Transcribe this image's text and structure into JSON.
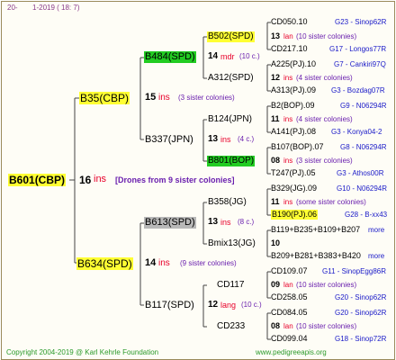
{
  "header": {
    "left": "20-",
    "date": "1-2019 ( 18: 7)"
  },
  "footer": {
    "copyright": "Copyright 2004-2019 @ Karl Kehrle Foundation",
    "url": "www.pedigreeapis.org"
  },
  "root": {
    "name": "B601(CBP)",
    "num": "16",
    "ins": "ins",
    "note": "[Drones from 9 sister colonies]"
  },
  "gen1": [
    {
      "name": "B35(CBP)",
      "num": "15",
      "ins": "ins",
      "note": "(3 sister colonies)"
    },
    {
      "name": "B634(SPD)",
      "num": "14",
      "ins": "ins",
      "note": "(9 sister colonies)"
    }
  ],
  "gen2": [
    {
      "name": "B484(SPD)",
      "num": "14",
      "ins": "mdr",
      "note": "(10 c.)"
    },
    {
      "name": "B337(JPN)",
      "num": "13",
      "ins": "ins",
      "note": "(4 c.)"
    },
    {
      "name": "B613(SPD)",
      "num": "13",
      "ins": "ins",
      "note": "(8 c.)"
    },
    {
      "name": "B117(SPD)",
      "num": "12",
      "ins": "lang",
      "note": "(10 c.)"
    }
  ],
  "gen3": [
    {
      "name": "B502(SPD)",
      "num": "13",
      "ins": "lan",
      "note": "(10 sister colonies)"
    },
    {
      "name": "A312(SPD)",
      "num": "12",
      "ins": "ins",
      "note": "(4 sister colonies)"
    },
    {
      "name": "B124(JPN)",
      "num": "11",
      "ins": "ins",
      "note": "(4 sister colonies)"
    },
    {
      "name": "B801(BOP)",
      "num": "08",
      "ins": "ins",
      "note": "(3 sister colonies)"
    },
    {
      "name": "B358(JG)",
      "num": "11",
      "ins": "ins",
      "note": "(some sister colonies)"
    },
    {
      "name": "Bmix13(JG)",
      "num": "10",
      "ins": "",
      "note": ""
    },
    {
      "name": "CD117",
      "num": "09",
      "ins": "lan",
      "note": "(10 sister colonies)"
    },
    {
      "name": "CD233",
      "num": "08",
      "ins": "lan",
      "note": "(10 sister colonies)"
    }
  ],
  "gen4": [
    {
      "name": "CD050.10",
      "id": "G23 - Sinop62R"
    },
    {
      "name": "CD217.10",
      "id": "G17 - Longos77R"
    },
    {
      "name": "A225(PJ).10",
      "id": "G7 - Cankiri97Q"
    },
    {
      "name": "A313(PJ).09",
      "id": "G3 - Bozdag07R"
    },
    {
      "name": "B2(BOP).09",
      "id": "G9 - N06294R"
    },
    {
      "name": "A141(PJ).08",
      "id": "G3 - Konya04-2"
    },
    {
      "name": "B107(BOP).07",
      "id": "G8 - N06294R"
    },
    {
      "name": "T247(PJ).05",
      "id": "G3 - Athos00R"
    },
    {
      "name": "B329(JG).09",
      "id": "G10 - N06294R"
    },
    {
      "name": "B190(PJ).06",
      "id": "G28 - B-xx43"
    },
    {
      "name": "B119+B235+B109+B207",
      "id": "more"
    },
    {
      "name": "B209+B281+B383+B420",
      "id": "more"
    },
    {
      "name": "CD109.07",
      "id": "G11 - SinopEgg86R"
    },
    {
      "name": "CD258.05",
      "id": "G20 - Sinop62R"
    },
    {
      "name": "CD084.05",
      "id": "G20 - Sinop62R"
    },
    {
      "name": "CD099.04",
      "id": "G18 - Sinop72R"
    }
  ]
}
